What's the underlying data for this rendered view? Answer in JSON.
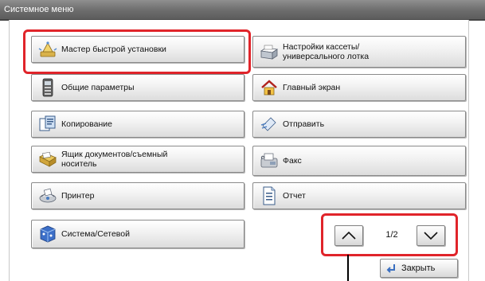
{
  "window": {
    "title": "Системное меню"
  },
  "menu": {
    "quick_setup": "Мастер быстрой установки",
    "cassette_mp_line1": "Настройки кассеты/",
    "cassette_mp_line2": "универсального лотка",
    "common_settings": "Общие параметры",
    "home_screen": "Главный экран",
    "copy": "Копирование",
    "send": "Отправить",
    "doc_box_line1": "Ящик документов/съемный",
    "doc_box_line2": "носитель",
    "fax": "Факс",
    "printer": "Принтер",
    "report": "Отчет",
    "system_network": "Система/Сетевой"
  },
  "pager": {
    "page_indicator": "1/2"
  },
  "footer": {
    "close_label": "Закрыть"
  },
  "colors": {
    "highlight": "#e0242a",
    "title_bar": "#6c6c6c"
  }
}
